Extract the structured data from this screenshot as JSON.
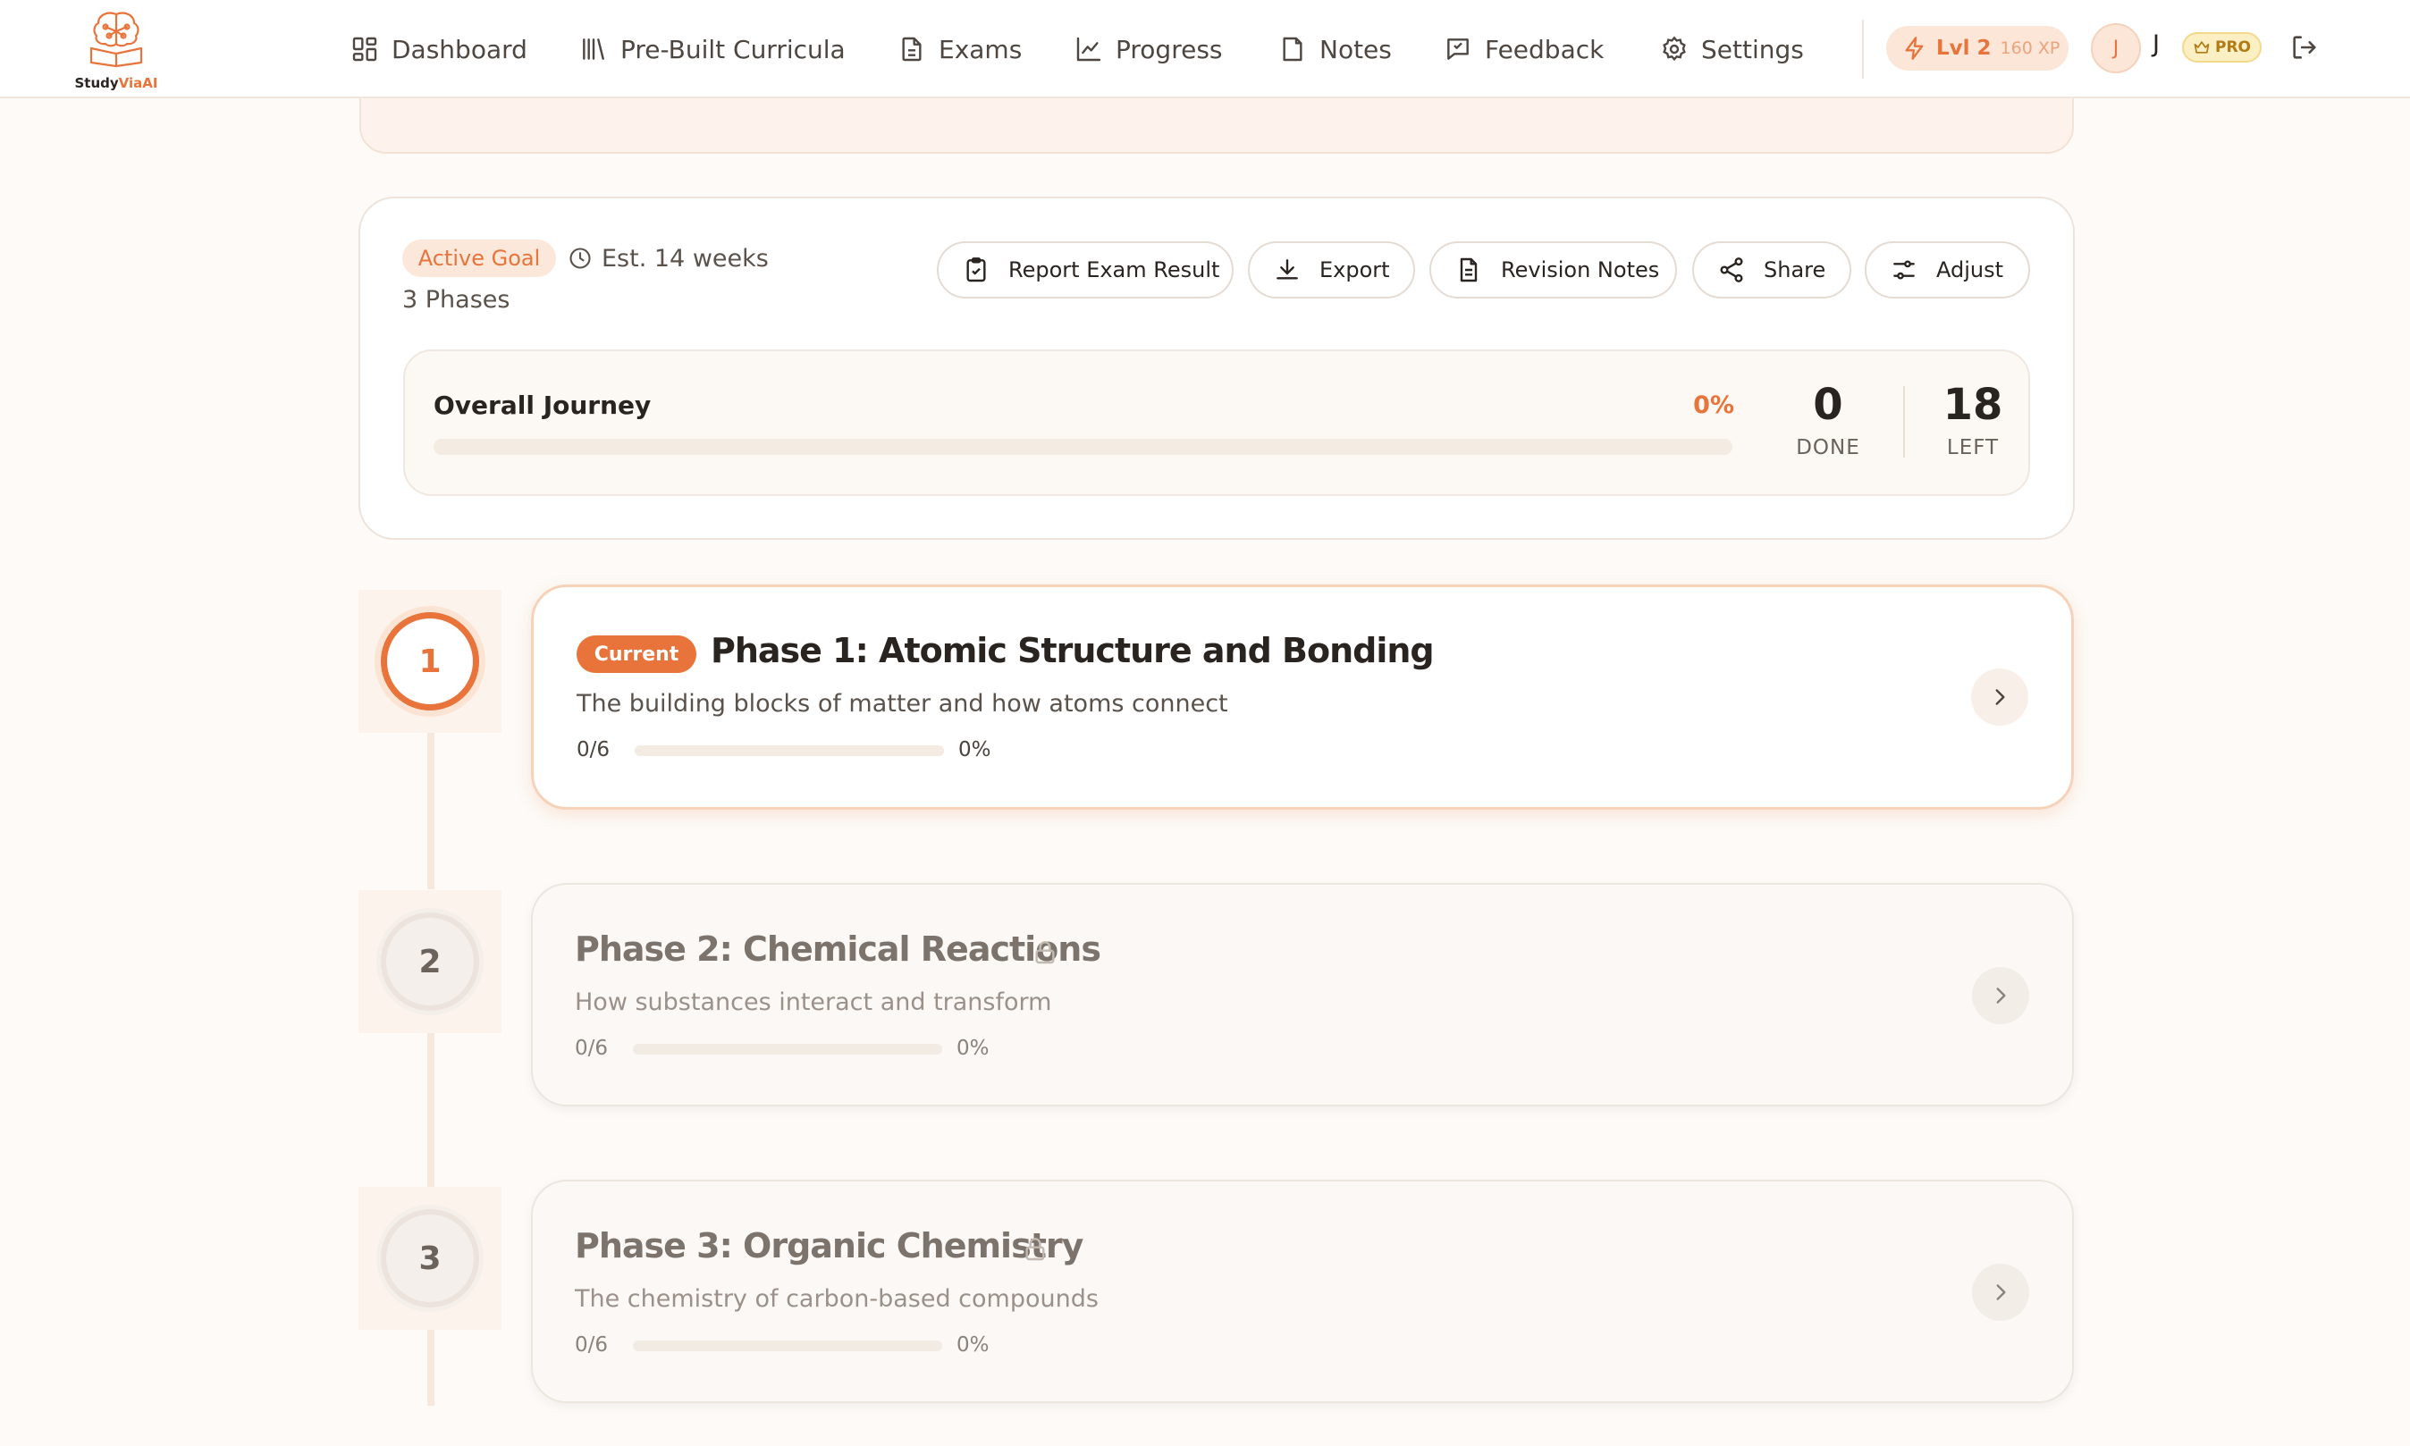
{
  "brand": {
    "name_part1": "Study",
    "name_part2": "ViaAI",
    "accent_color": "#e8743b"
  },
  "nav": {
    "items": [
      {
        "label": "Dashboard",
        "icon": "dashboard-grid-icon"
      },
      {
        "label": "Pre-Built Curricula",
        "icon": "library-icon"
      },
      {
        "label": "Exams",
        "icon": "document-icon"
      },
      {
        "label": "Progress",
        "icon": "line-chart-icon"
      },
      {
        "label": "Notes",
        "icon": "note-icon"
      },
      {
        "label": "Feedback",
        "icon": "message-square-icon"
      },
      {
        "label": "Settings",
        "icon": "gear-icon"
      }
    ]
  },
  "user": {
    "level": "Lvl 2",
    "xp": "160 XP",
    "avatar_initial": "J",
    "name_initial": "J",
    "plan": "PRO"
  },
  "goal": {
    "status": "Active Goal",
    "estimate": "Est. 14 weeks",
    "phases": "3 Phases",
    "actions": [
      {
        "label": "Report Exam Result",
        "icon": "clipboard-check-icon"
      },
      {
        "label": "Export",
        "icon": "download-icon"
      },
      {
        "label": "Revision Notes",
        "icon": "file-text-icon"
      },
      {
        "label": "Share",
        "icon": "share-icon"
      },
      {
        "label": "Adjust",
        "icon": "sliders-icon"
      }
    ],
    "journey": {
      "title": "Overall Journey",
      "percent_label": "0%",
      "progress_fraction": 0,
      "done_value": "0",
      "done_label": "DONE",
      "left_value": "18",
      "left_label": "LEFT"
    }
  },
  "phases": [
    {
      "number": "1",
      "badge": "Current",
      "title": "Phase 1: Atomic Structure and Bonding",
      "description": "The building blocks of matter and how atoms connect",
      "count": "0/6",
      "percent_label": "0%",
      "progress_fraction": 0,
      "locked": false
    },
    {
      "number": "2",
      "title": "Phase 2: Chemical Reactions",
      "description": "How substances interact and transform",
      "count": "0/6",
      "percent_label": "0%",
      "progress_fraction": 0,
      "locked": true
    },
    {
      "number": "3",
      "title": "Phase 3: Organic Chemistry",
      "description": "The chemistry of carbon-based compounds",
      "count": "0/6",
      "percent_label": "0%",
      "progress_fraction": 0,
      "locked": true
    }
  ]
}
